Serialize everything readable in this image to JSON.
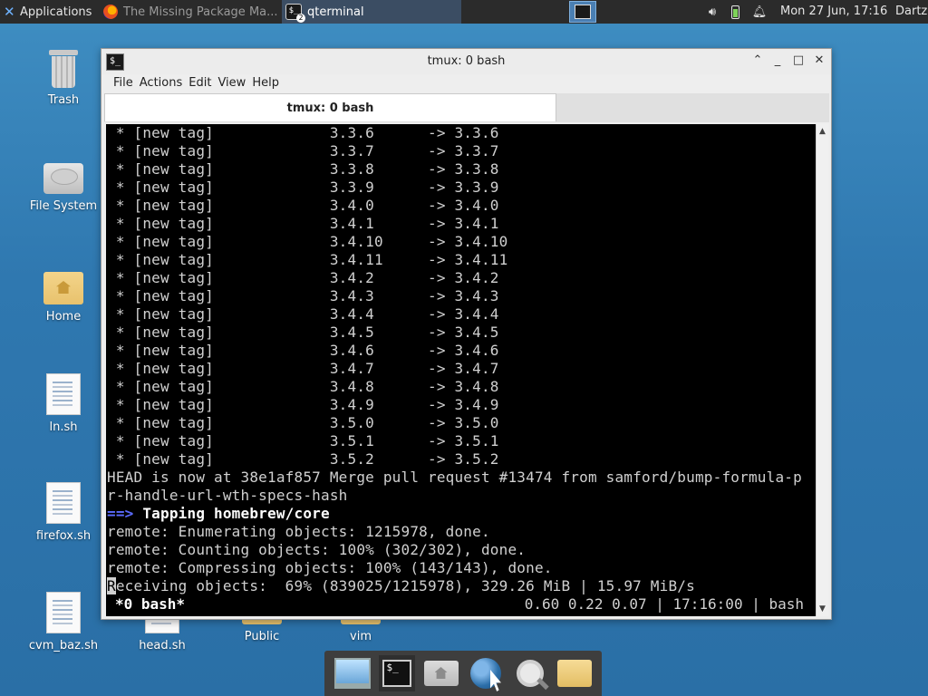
{
  "top_panel": {
    "applications_label": "Applications",
    "tasks": [
      {
        "label": "The Missing Package Ma...",
        "icon": "firefox-icon",
        "state": "inactive"
      },
      {
        "label": "qterminal",
        "icon": "terminal-icon",
        "state": "active",
        "badge": "2"
      }
    ],
    "clock": "Mon 27 Jun, 17:16",
    "user": "Dartz",
    "tray_icons": [
      "volume-icon",
      "battery-icon",
      "notification-bell-icon"
    ]
  },
  "desktop": {
    "icons": [
      {
        "label": "Trash",
        "kind": "trash"
      },
      {
        "label": "File System",
        "kind": "drive"
      },
      {
        "label": "Home",
        "kind": "home-folder"
      },
      {
        "label": "ln.sh",
        "kind": "script"
      },
      {
        "label": "firefox.sh",
        "kind": "script"
      },
      {
        "label": "cvm_baz.sh",
        "kind": "script"
      },
      {
        "label": "head.sh",
        "kind": "script"
      },
      {
        "label": "Public",
        "kind": "folder"
      },
      {
        "label": "vim",
        "kind": "folder"
      }
    ]
  },
  "window": {
    "title": "tmux: 0 bash",
    "menu": [
      "File",
      "Actions",
      "Edit",
      "View",
      "Help"
    ],
    "tab_label": "tmux: 0 bash"
  },
  "terminal": {
    "lines": [
      " * [new tag]             3.3.6      -> 3.3.6",
      " * [new tag]             3.3.7      -> 3.3.7",
      " * [new tag]             3.3.8      -> 3.3.8",
      " * [new tag]             3.3.9      -> 3.3.9",
      " * [new tag]             3.4.0      -> 3.4.0",
      " * [new tag]             3.4.1      -> 3.4.1",
      " * [new tag]             3.4.10     -> 3.4.10",
      " * [new tag]             3.4.11     -> 3.4.11",
      " * [new tag]             3.4.2      -> 3.4.2",
      " * [new tag]             3.4.3      -> 3.4.3",
      " * [new tag]             3.4.4      -> 3.4.4",
      " * [new tag]             3.4.5      -> 3.4.5",
      " * [new tag]             3.4.6      -> 3.4.6",
      " * [new tag]             3.4.7      -> 3.4.7",
      " * [new tag]             3.4.8      -> 3.4.8",
      " * [new tag]             3.4.9      -> 3.4.9",
      " * [new tag]             3.5.0      -> 3.5.0",
      " * [new tag]             3.5.1      -> 3.5.1",
      " * [new tag]             3.5.2      -> 3.5.2",
      "HEAD is now at 38e1af857 Merge pull request #13474 from samford/bump-formula-p",
      "r-handle-url-wth-specs-hash"
    ],
    "tap_arrow": "==>",
    "tap_text": " Tapping homebrew/core",
    "remote_lines": [
      "remote: Enumerating objects: 1215978, done.",
      "remote: Counting objects: 100% (302/302), done.",
      "remote: Compressing objects: 100% (143/143), done."
    ],
    "cursor_char": "R",
    "receiving_rest": "eceiving objects:  69% (839025/1215978), 329.26 MiB | 15.97 MiB/s",
    "status_left": "*0 bash*",
    "status_right": "0.60 0.22 0.07 | 17:16:00 | bash"
  },
  "dock": {
    "items": [
      "workspaces-icon",
      "terminal-icon",
      "home-folder-icon",
      "web-browser-icon",
      "search-icon",
      "file-manager-icon"
    ]
  }
}
